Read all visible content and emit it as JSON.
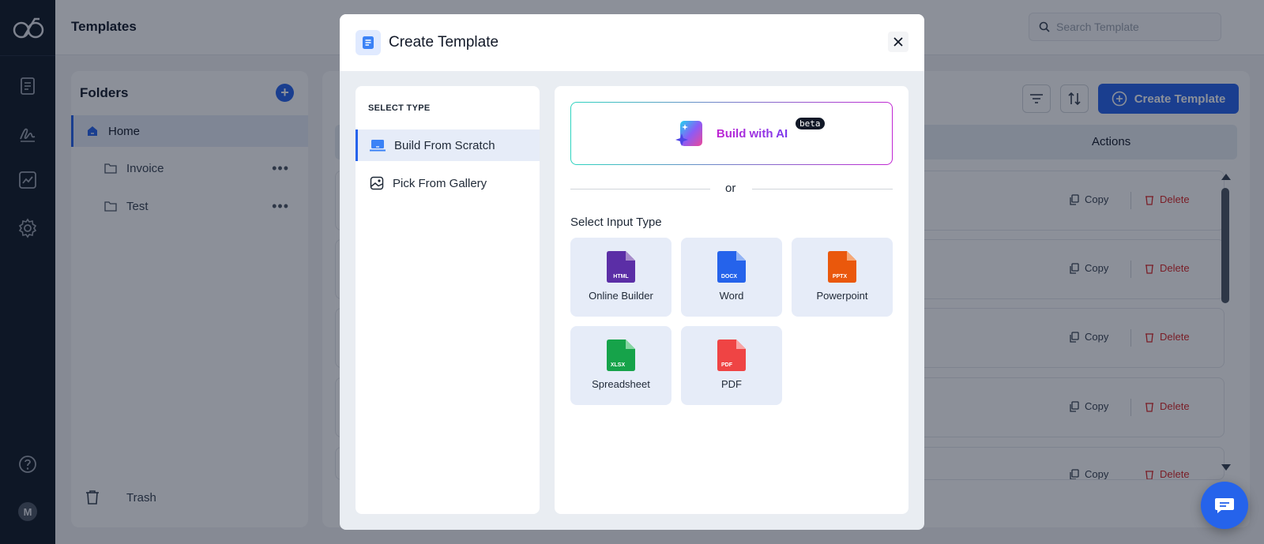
{
  "app": {
    "page_title": "Templates",
    "search_placeholder": "Search Template"
  },
  "folders": {
    "title": "Folders",
    "home": "Home",
    "items": [
      "Invoice",
      "Test"
    ],
    "trash": "Trash"
  },
  "main": {
    "create_button": "Create Template",
    "actions_header": "Actions",
    "row_copy": "Copy",
    "row_delete": "Delete"
  },
  "user": {
    "initial": "M"
  },
  "modal": {
    "title": "Create Template",
    "select_type_caption": "SELECT TYPE",
    "types": [
      "Build From Scratch",
      "Pick From Gallery"
    ],
    "active_type": "Build From Scratch",
    "ai_label": "Build with AI",
    "ai_badge": "beta",
    "or_text": "or",
    "input_type_heading": "Select Input Type",
    "input_types": [
      {
        "label": "Online Builder",
        "badge": "HTML",
        "color": "#5b2ea6"
      },
      {
        "label": "Word",
        "badge": "DOCX",
        "color": "#2563eb"
      },
      {
        "label": "Powerpoint",
        "badge": "PPTX",
        "color": "#ea580c"
      },
      {
        "label": "Spreadsheet",
        "badge": "XLSX",
        "color": "#16a34a"
      },
      {
        "label": "PDF",
        "badge": "PDF",
        "color": "#ef4444"
      }
    ]
  },
  "colors": {
    "accent": "#2563eb",
    "rail": "#0f1724",
    "danger": "#dc2626"
  }
}
